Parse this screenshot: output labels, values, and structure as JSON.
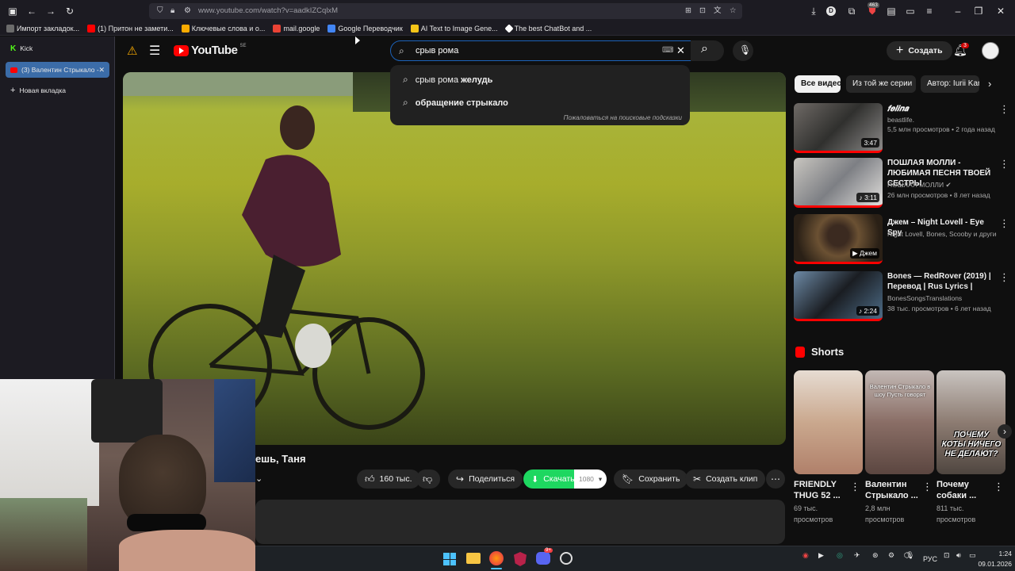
{
  "browser": {
    "url": "www.youtube.com/watch?v=aadkIZCqlxM",
    "bookmarks": [
      {
        "label": "Импорт закладок...",
        "color": "#6b6b6b"
      },
      {
        "label": "(1) Притон не замети...",
        "color": "#ff0000"
      },
      {
        "label": "Ключевые слова и о...",
        "color": "#f9ab00"
      },
      {
        "label": "mail.google",
        "color": "#ea4335"
      },
      {
        "label": "Google Переводчик",
        "color": "#4285f4"
      },
      {
        "label": "AI Text to Image Gene...",
        "color": "#f5c518"
      },
      {
        "label": "The best ChatBot and ...",
        "color": "#ffffff"
      }
    ],
    "notification_badge": "463"
  },
  "sidebar": {
    "tabs": [
      {
        "label": "Kick",
        "active": false
      },
      {
        "label": "(3) Валентин Стрыкало -",
        "active": true
      },
      {
        "label": "Новая вкладка",
        "active": false
      }
    ]
  },
  "youtube": {
    "logo_text": "YouTube",
    "logo_region": "SE",
    "search_value": "срыв рома",
    "suggestions": [
      {
        "prefix": "срыв рома ",
        "bold": "желудь"
      },
      {
        "prefix": "",
        "bold": "обращение стрыкало"
      }
    ],
    "suggest_report": "Пожаловаться на поисковые подсказки",
    "create_label": "Создать",
    "notif_count": "3",
    "video_title_visible": "ешь, Таня",
    "actions": {
      "likes": "160 тыс.",
      "share": "Поделиться",
      "download": "Скачать",
      "quality": "1080",
      "save": "Сохранить",
      "clip": "Создать клип"
    },
    "chips": [
      "Все видео",
      "Из той же серии",
      "Автор: Iurii Kar"
    ],
    "recommendations": [
      {
        "title": "𝒇𝒆𝒍𝒊𝒏𝒂",
        "channel": "beastlife.",
        "meta": "5,5 млн просмотров • 2 года назад",
        "duration": "3:47",
        "verified": false
      },
      {
        "title": "ПОШЛАЯ МОЛЛИ - ЛЮБИМАЯ ПЕСНЯ ТВОЕЙ СЕСТРЫ",
        "channel": "ПОШЛАЯ МОЛЛИ",
        "meta": "26 млн просмотров • 8 лет назад",
        "duration": "3:11",
        "verified": true
      },
      {
        "title": "Джем – Night Lovell - Eye Spy",
        "channel": "Night Lovell, Bones, Scooby и другие ис...",
        "meta": "",
        "duration": "Джем",
        "verified": false
      },
      {
        "title": "Bones — RedRover (2019) | Перевод | Rus Lyrics |",
        "channel": "BonesSongsTranslations",
        "meta": "38 тыс. просмотров • 6 лет назад",
        "duration": "2:24",
        "verified": false
      }
    ],
    "shorts_header": "Shorts",
    "shorts": [
      {
        "title": "FRIENDLY THUG 52 ...",
        "views": "69 тыс.",
        "views_unit": "просмотров",
        "overlay": ""
      },
      {
        "title": "Валентин Стрыкало ...",
        "views": "2,8 млн",
        "views_unit": "просмотров",
        "overlay": "Валентин Стрыкало в шоу Пусть говорят"
      },
      {
        "title": "Почему собаки ...",
        "views": "811 тыс.",
        "views_unit": "просмотров",
        "overlay": "ПОЧЕМУ КОТЫ НИЧЕГО НЕ ДЕЛАЮТ?"
      }
    ]
  },
  "taskbar": {
    "lang": "РУС",
    "time": "1:24",
    "date": "09.01.2026",
    "discord_badge": "9+"
  }
}
